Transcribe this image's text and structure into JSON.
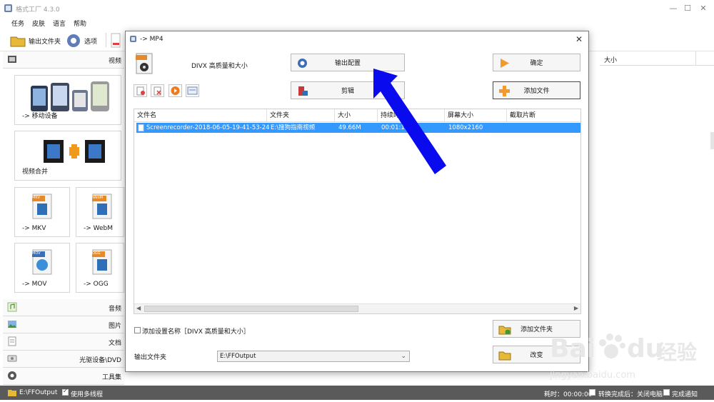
{
  "window": {
    "title": "格式工厂 4.3.0"
  },
  "menu": [
    "任务",
    "皮肤",
    "语言",
    "帮助"
  ],
  "toolbar": {
    "output_folder": "输出文件夹",
    "options": "选项"
  },
  "left": {
    "video_label": "视频",
    "tiles": {
      "mobile": "-> 移动设备",
      "merge": "视频合并",
      "mkv": "-> MKV",
      "webm": "-> WebM",
      "mov": "-> MOV",
      "ogg": "-> OGG",
      "mov_badge": "MOV",
      "ogg_badge": "OGG",
      "mkv_badge": "MKV",
      "webm_badge": "WebM"
    },
    "categories": [
      "音频",
      "图片",
      "文档",
      "光驱设备\\DVD",
      "工具集"
    ]
  },
  "right": {
    "size_header": "大小"
  },
  "dialog": {
    "title": "-> MP4",
    "preset_label": "DIVX 高质量和大小",
    "output_config": "输出配置",
    "confirm": "确定",
    "clip": "剪辑",
    "add_file": "添加文件",
    "table": {
      "headers": [
        "文件名",
        "文件夹",
        "大小",
        "持续时间",
        "屏幕大小",
        "截取片断"
      ],
      "rows": [
        {
          "name": "Screenrecorder-2018-06-05-19-41-53-24...",
          "folder": "E:\\搜狗指南视频",
          "size": "49.66M",
          "duration": "00:01:1",
          "screen": "1080x2160",
          "clip": ""
        }
      ]
    },
    "add_setting_name": "添加设置名称［DIVX 高质量和大小］",
    "add_folder": "添加文件夹",
    "output_folder_label": "输出文件夹",
    "output_folder_value": "E:\\FFOutput",
    "change": "改变"
  },
  "status": {
    "path": "E:\\FFOutput",
    "multithread": "使用多线程",
    "elapsed": "耗时：00:00:00",
    "after_convert": "转换完成后：关闭电脑",
    "notify": "完成通知"
  },
  "watermark": {
    "brand": "Bai",
    "brand2": "du",
    "cn": "经验",
    "url": "jingyan.baidu.com"
  },
  "colors": {
    "selection": "#3399ff",
    "arrow": "#0000ee",
    "statusbar": "#5a5a5a"
  }
}
